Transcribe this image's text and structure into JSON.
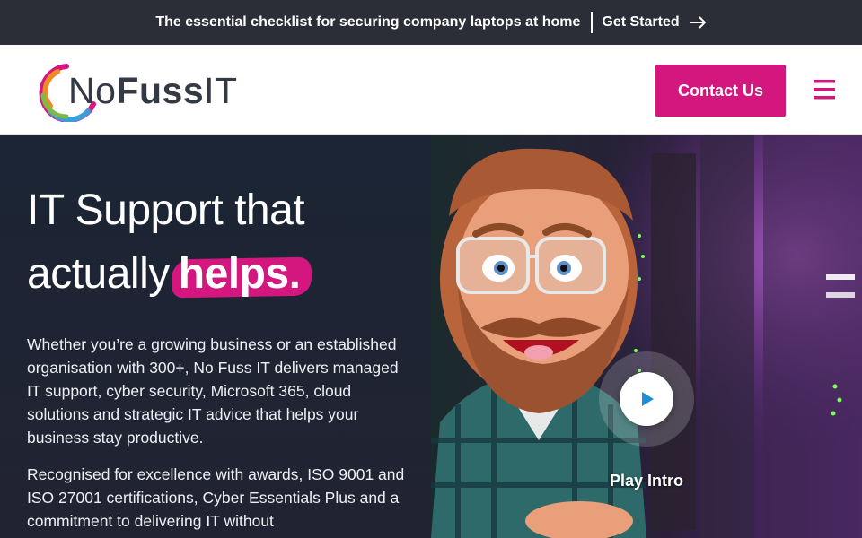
{
  "announcement": {
    "message": "The essential checklist for securing company laptops at home",
    "cta_label": "Get Started",
    "cta_icon": "arrow-right-icon"
  },
  "header": {
    "logo": {
      "text_light_1": "No",
      "text_bold": "Fuss",
      "text_light_2": "IT"
    },
    "contact_label": "Contact Us",
    "menu_icon": "hamburger-menu-icon"
  },
  "hero": {
    "title_line1": "IT Support that",
    "title_line2": "actually",
    "title_highlight": "helps.",
    "paragraph1": "Whether you’re a growing business or an established organisation with 300+, No Fuss IT delivers managed IT support, cyber security, Microsoft 365, cloud solutions and strategic IT advice that helps your business stay productive.",
    "paragraph2": "Recognised for excellence with awards, ISO 9001 and ISO 27001 certifications, Cyber Essentials Plus and a commitment to delivering IT without",
    "video": {
      "play_label": "Play Intro",
      "play_icon": "play-icon"
    }
  },
  "colors": {
    "brand_pink": "#d4177f",
    "topbar_bg": "#2b2e37",
    "hero_bg": "#1b2535"
  }
}
